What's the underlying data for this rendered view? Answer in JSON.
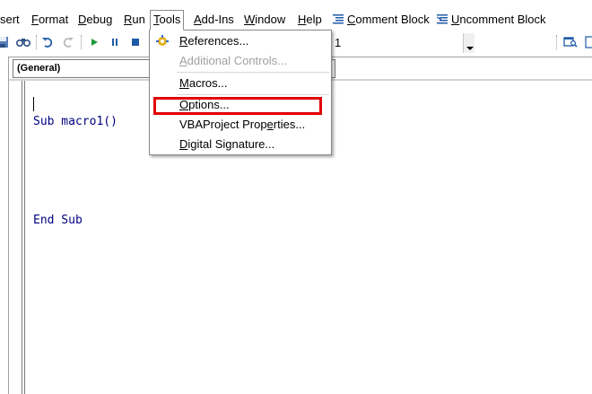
{
  "menubar": {
    "insert_tail": "sert",
    "format": {
      "first": "F",
      "rest": "ormat"
    },
    "debug": {
      "first": "D",
      "rest": "ebug"
    },
    "run": {
      "first": "R",
      "rest": "un"
    },
    "tools": {
      "first": "T",
      "rest": "ools"
    },
    "addins": {
      "first": "A",
      "rest": "dd-Ins"
    },
    "window": {
      "first": "W",
      "rest": "indow"
    },
    "help": {
      "first": "H",
      "rest": "elp"
    },
    "comment_block": {
      "first": "C",
      "rest": "omment Block",
      "icon": "comment-block-icon"
    },
    "uncomment_block": {
      "first": "U",
      "rest": "ncomment Block",
      "icon": "uncomment-block-icon"
    }
  },
  "toolbar": {
    "icons": [
      "save-icon",
      "find-icon",
      "undo-icon",
      "redo-icon",
      "run-icon",
      "break-icon",
      "reset-icon",
      "object-browser-icon",
      "scroll-icon"
    ],
    "procedure_combo_value": "1"
  },
  "code_window": {
    "object_combo_value": "(General)",
    "lines": [
      "Sub macro1()",
      "",
      "End Sub"
    ],
    "code_color": "#000080"
  },
  "tools_menu": {
    "items": [
      {
        "pre": "",
        "ul": "R",
        "post": "eferences...",
        "enabled": true,
        "icon": "references-icon"
      },
      {
        "pre": "",
        "ul": "A",
        "post": "dditional Controls...",
        "enabled": false
      },
      {
        "pre": "",
        "ul": "M",
        "post": "acros...",
        "enabled": true
      },
      {
        "pre": "",
        "ul": "O",
        "post": "ptions...",
        "enabled": true,
        "highlighted": true
      },
      {
        "pre": "VBAProject Prop",
        "ul": "e",
        "post": "rties...",
        "enabled": true
      },
      {
        "pre": "",
        "ul": "D",
        "post": "igital Signature...",
        "enabled": true
      }
    ],
    "highlight_color": "#e20000"
  }
}
